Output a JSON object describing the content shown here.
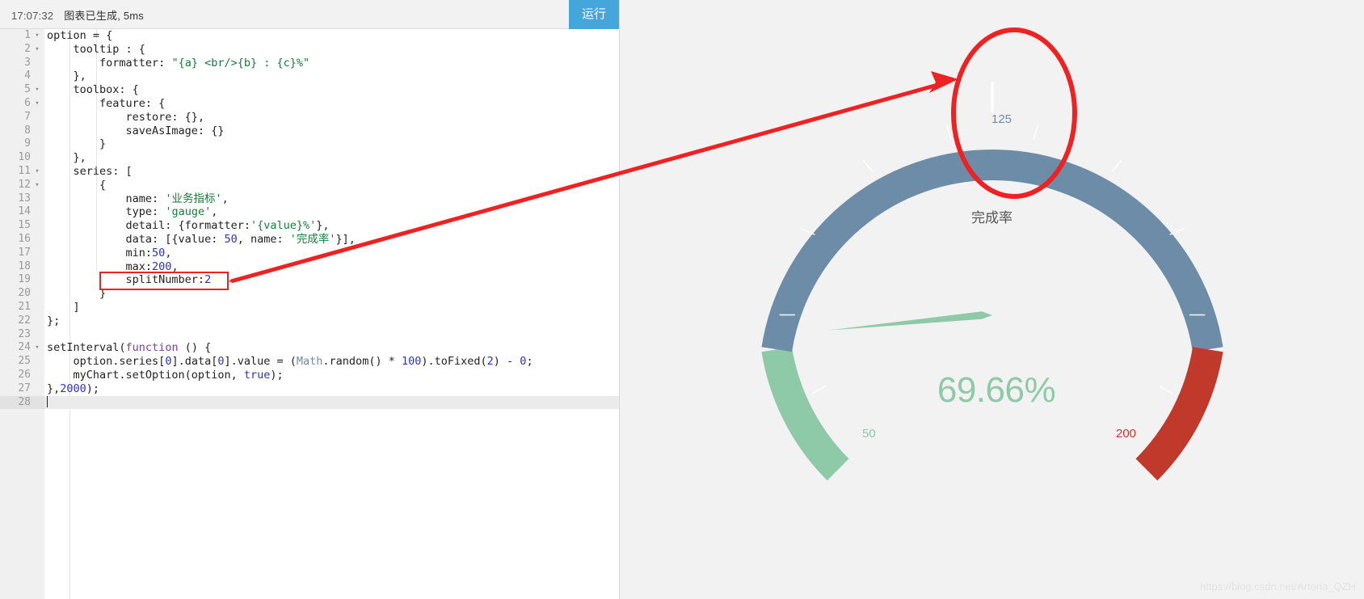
{
  "editor": {
    "status": {
      "timestamp": "17:07:32",
      "message": "图表已生成, 5ms"
    },
    "run_button_label": "运行",
    "lines": [
      {
        "n": "1",
        "fold": "▾",
        "html": "option = {"
      },
      {
        "n": "2",
        "fold": "▾",
        "html": "    tooltip : {"
      },
      {
        "n": "3",
        "fold": "",
        "html": "        formatter: <span class=\"t-str\">\"{a} &lt;br/&gt;{b} : {c}%\"</span>"
      },
      {
        "n": "4",
        "fold": "",
        "html": "    },"
      },
      {
        "n": "5",
        "fold": "▾",
        "html": "    toolbox: {"
      },
      {
        "n": "6",
        "fold": "▾",
        "html": "        feature: {"
      },
      {
        "n": "7",
        "fold": "",
        "html": "            restore: {},"
      },
      {
        "n": "8",
        "fold": "",
        "html": "            saveAsImage: {}"
      },
      {
        "n": "9",
        "fold": "",
        "html": "        }"
      },
      {
        "n": "10",
        "fold": "",
        "html": "    },"
      },
      {
        "n": "11",
        "fold": "▾",
        "html": "    series: ["
      },
      {
        "n": "12",
        "fold": "▾",
        "html": "        {"
      },
      {
        "n": "13",
        "fold": "",
        "html": "            name: <span class=\"t-str\">'业务指标'</span>,"
      },
      {
        "n": "14",
        "fold": "",
        "html": "            type: <span class=\"t-str\">'gauge'</span>,"
      },
      {
        "n": "15",
        "fold": "",
        "html": "            detail: {formatter:<span class=\"t-str\">'{value}%'</span>},"
      },
      {
        "n": "16",
        "fold": "",
        "html": "            data: [{value: <span class=\"t-num\">50</span>, name: <span class=\"t-str\">'完成率'</span>}],"
      },
      {
        "n": "17",
        "fold": "",
        "html": "            min:<span class=\"t-num\">50</span>,"
      },
      {
        "n": "18",
        "fold": "",
        "html": "            max:<span class=\"t-num\">200</span>,"
      },
      {
        "n": "19",
        "fold": "",
        "html": "            splitNumber:<span class=\"t-num\">2</span>"
      },
      {
        "n": "20",
        "fold": "",
        "html": "        }"
      },
      {
        "n": "21",
        "fold": "",
        "html": "    ]"
      },
      {
        "n": "22",
        "fold": "",
        "html": "};"
      },
      {
        "n": "23",
        "fold": "",
        "html": ""
      },
      {
        "n": "24",
        "fold": "▾",
        "html": "setInterval(<span class=\"t-kw\">function</span> () {"
      },
      {
        "n": "25",
        "fold": "",
        "html": "    option.series[<span class=\"t-num\">0</span>].data[<span class=\"t-num\">0</span>].value = (<span class=\"t-fn\">Math</span>.random() * <span class=\"t-num\">100</span>).toFixed(<span class=\"t-num\">2</span>) - <span class=\"t-num\">0</span>;"
      },
      {
        "n": "26",
        "fold": "",
        "html": "    myChart.setOption(option, <span class=\"t-bool\">true</span>);"
      },
      {
        "n": "27",
        "fold": "",
        "html": "},<span class=\"t-num\">2000</span>);"
      },
      {
        "n": "28",
        "fold": "",
        "html": "<span class=\"caret\"></span>"
      }
    ],
    "current_line": 28,
    "code_text": "option = {\n    tooltip : {\n        formatter: \"{a} <br/>{b} : {c}%\"\n    },\n    toolbox: {\n        feature: {\n            restore: {},\n            saveAsImage: {}\n        }\n    },\n    series: [\n        {\n            name: '业务指标',\n            type: 'gauge',\n            detail: {formatter:'{value}%'},\n            data: [{value: 50, name: '完成率'}],\n            min:50,\n            max:200,\n            splitNumber:2\n        }\n    ]\n};\n\nsetInterval(function () {\n    option.series[0].data[0].value = (Math.random() * 100).toFixed(2) - 0;\n    myChart.setOption(option, true);\n},2000);\n"
  },
  "chart_data": {
    "type": "gauge",
    "title": "",
    "series_name": "业务指标",
    "label": "完成率",
    "detail_text": "69.66%",
    "value": 69.66,
    "min": 50,
    "max": 200,
    "split_number": 2,
    "axis_tick_labels": [
      "50",
      "125",
      "200"
    ],
    "axis_tick_values": [
      50,
      125,
      200
    ],
    "start_angle": 225,
    "end_angle": -45,
    "axis_line_segments": [
      {
        "to_fraction": 0.2,
        "color": "#8ec9a8",
        "label_color": "#8ec9a8"
      },
      {
        "to_fraction": 0.8,
        "color": "#6d8ca8",
        "label_color": "#6d8ca8"
      },
      {
        "to_fraction": 1.0,
        "color": "#c0392b",
        "label_color": "#c0392b"
      }
    ],
    "pointer_color": "#8ec9a8",
    "background": "#f2f2f2"
  },
  "annotations": {
    "watermark": "https://blog.csdn.net/Artoria_QZH",
    "highlight_color": "#ee2222",
    "code_box_target": "splitNumber:2",
    "ellipse_target": "125"
  }
}
